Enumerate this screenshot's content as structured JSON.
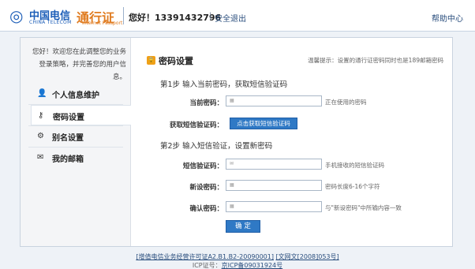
{
  "header": {
    "logo_cn": "中国电信",
    "logo_en": "CHINA TELECOM",
    "brand_cn": "通行证",
    "brand_en": "Internet Passport",
    "greeting": "您好！13391432796",
    "separator": "|",
    "logout": "安全退出",
    "help": "帮助中心"
  },
  "sidebar": {
    "welcome": "您好！欢迎您在此调整您的业务登录策略，并完善您的用户信息。",
    "items": [
      {
        "label": "个人信息维护",
        "icon": "user-icon"
      },
      {
        "label": "密码设置",
        "icon": "key-icon"
      },
      {
        "label": "别名设置",
        "icon": "tag-icon"
      },
      {
        "label": "我的邮箱",
        "icon": "mail-icon"
      }
    ]
  },
  "main": {
    "title": "密码设置",
    "tip": "温馨提示：设置的通行证密码同时也是189邮箱密码",
    "step1": "第1步  输入当前密码，获取短信验证码",
    "step2": "第2步  输入短信验证，设置新密码",
    "current_password_label": "当前密码：",
    "current_password_hint": "正在使用的密码",
    "sms_label": "获取短信验证码：",
    "sms_button": "点击获取短信验证码",
    "verify_label": "短信验证码：",
    "verify_hint": "手机接收的短信验证码",
    "new_password_label": "新设密码：",
    "new_password_hint": "密码长度6-16个字符",
    "confirm_password_label": "确认密码：",
    "confirm_password_hint": "与\"新设密码\"中所输内容一致",
    "submit": "确 定"
  },
  "footer": {
    "line1_a": "[增值电信业务经营许可证A2.B1.B2-20090001]",
    "line1_b": "[文网文[2008]053号]",
    "line2_prefix": "ICP证号：",
    "line2_link": "京ICP备09031924号"
  }
}
